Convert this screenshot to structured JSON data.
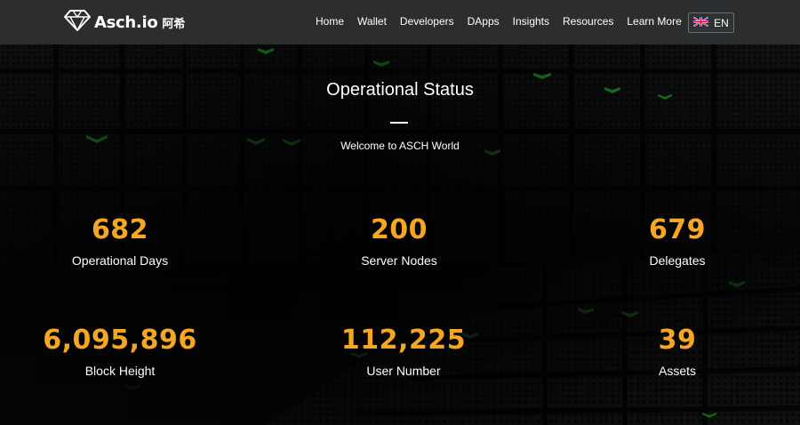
{
  "brand": {
    "name": "Asch.io",
    "cn": "阿希"
  },
  "nav": {
    "items": [
      {
        "label": "Home"
      },
      {
        "label": "Wallet"
      },
      {
        "label": "Developers"
      },
      {
        "label": "DApps"
      },
      {
        "label": "Insights"
      },
      {
        "label": "Resources"
      },
      {
        "label": "Learn More"
      }
    ],
    "language": "EN"
  },
  "hero": {
    "title": "Operational Status",
    "subtitle": "Welcome to ASCH World"
  },
  "stats": [
    {
      "value": "682",
      "label": "Operational Days"
    },
    {
      "value": "200",
      "label": "Server Nodes"
    },
    {
      "value": "679",
      "label": "Delegates"
    },
    {
      "value": "6,095,896",
      "label": "Block Height"
    },
    {
      "value": "112,225",
      "label": "User Number"
    },
    {
      "value": "39",
      "label": "Assets"
    }
  ],
  "colors": {
    "accent": "#f5a623",
    "navbar": "#2b2d2e"
  }
}
